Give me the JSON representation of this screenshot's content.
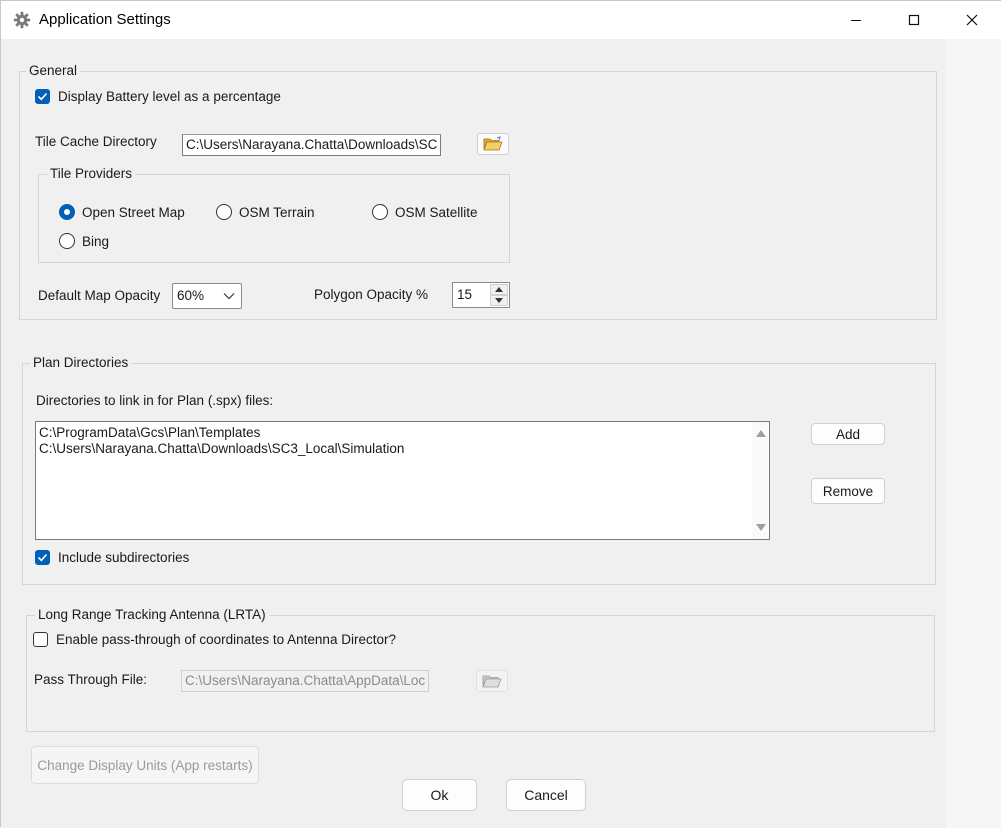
{
  "window": {
    "title": "Application Settings",
    "icons": {
      "app": "gear-icon",
      "minimize": "minimize-icon",
      "maximize": "maximize-icon",
      "close": "close-icon"
    }
  },
  "general": {
    "legend": "General",
    "battery_label": "Display Battery level as a percentage",
    "battery_checked": true,
    "tile_cache_label": "Tile Cache Directory",
    "tile_cache_value": "C:\\Users\\Narayana.Chatta\\Downloads\\SC",
    "tile_providers": {
      "legend": "Tile Providers",
      "options": [
        "Open Street Map",
        "OSM Terrain",
        "OSM Satellite",
        "Bing"
      ],
      "selected": "Open Street Map"
    },
    "map_opacity_label": "Default Map Opacity",
    "map_opacity_value": "60%",
    "polygon_opacity_label": "Polygon Opacity %",
    "polygon_opacity_value": "15"
  },
  "plan": {
    "legend": "Plan Directories",
    "description": "Directories to link in for Plan (.spx) files:",
    "directories": [
      "C:\\ProgramData\\Gcs\\Plan\\Templates",
      "C:\\Users\\Narayana.Chatta\\Downloads\\SC3_Local\\Simulation"
    ],
    "add_label": "Add",
    "remove_label": "Remove",
    "include_sub_label": "Include subdirectories",
    "include_sub_checked": true
  },
  "lrta": {
    "legend": "Long Range Tracking Antenna (LRTA)",
    "enable_label": "Enable pass-through of coordinates to Antenna Director?",
    "enable_checked": false,
    "pass_label": "Pass Through File:",
    "pass_value": "C:\\Users\\Narayana.Chatta\\AppData\\Loc"
  },
  "footer": {
    "units_label": "Change Display Units (App restarts)",
    "ok_label": "Ok",
    "cancel_label": "Cancel"
  },
  "colors": {
    "accent": "#005fb8",
    "window_bg": "#f0f0f0",
    "titlebar_bg": "#ffffff"
  }
}
